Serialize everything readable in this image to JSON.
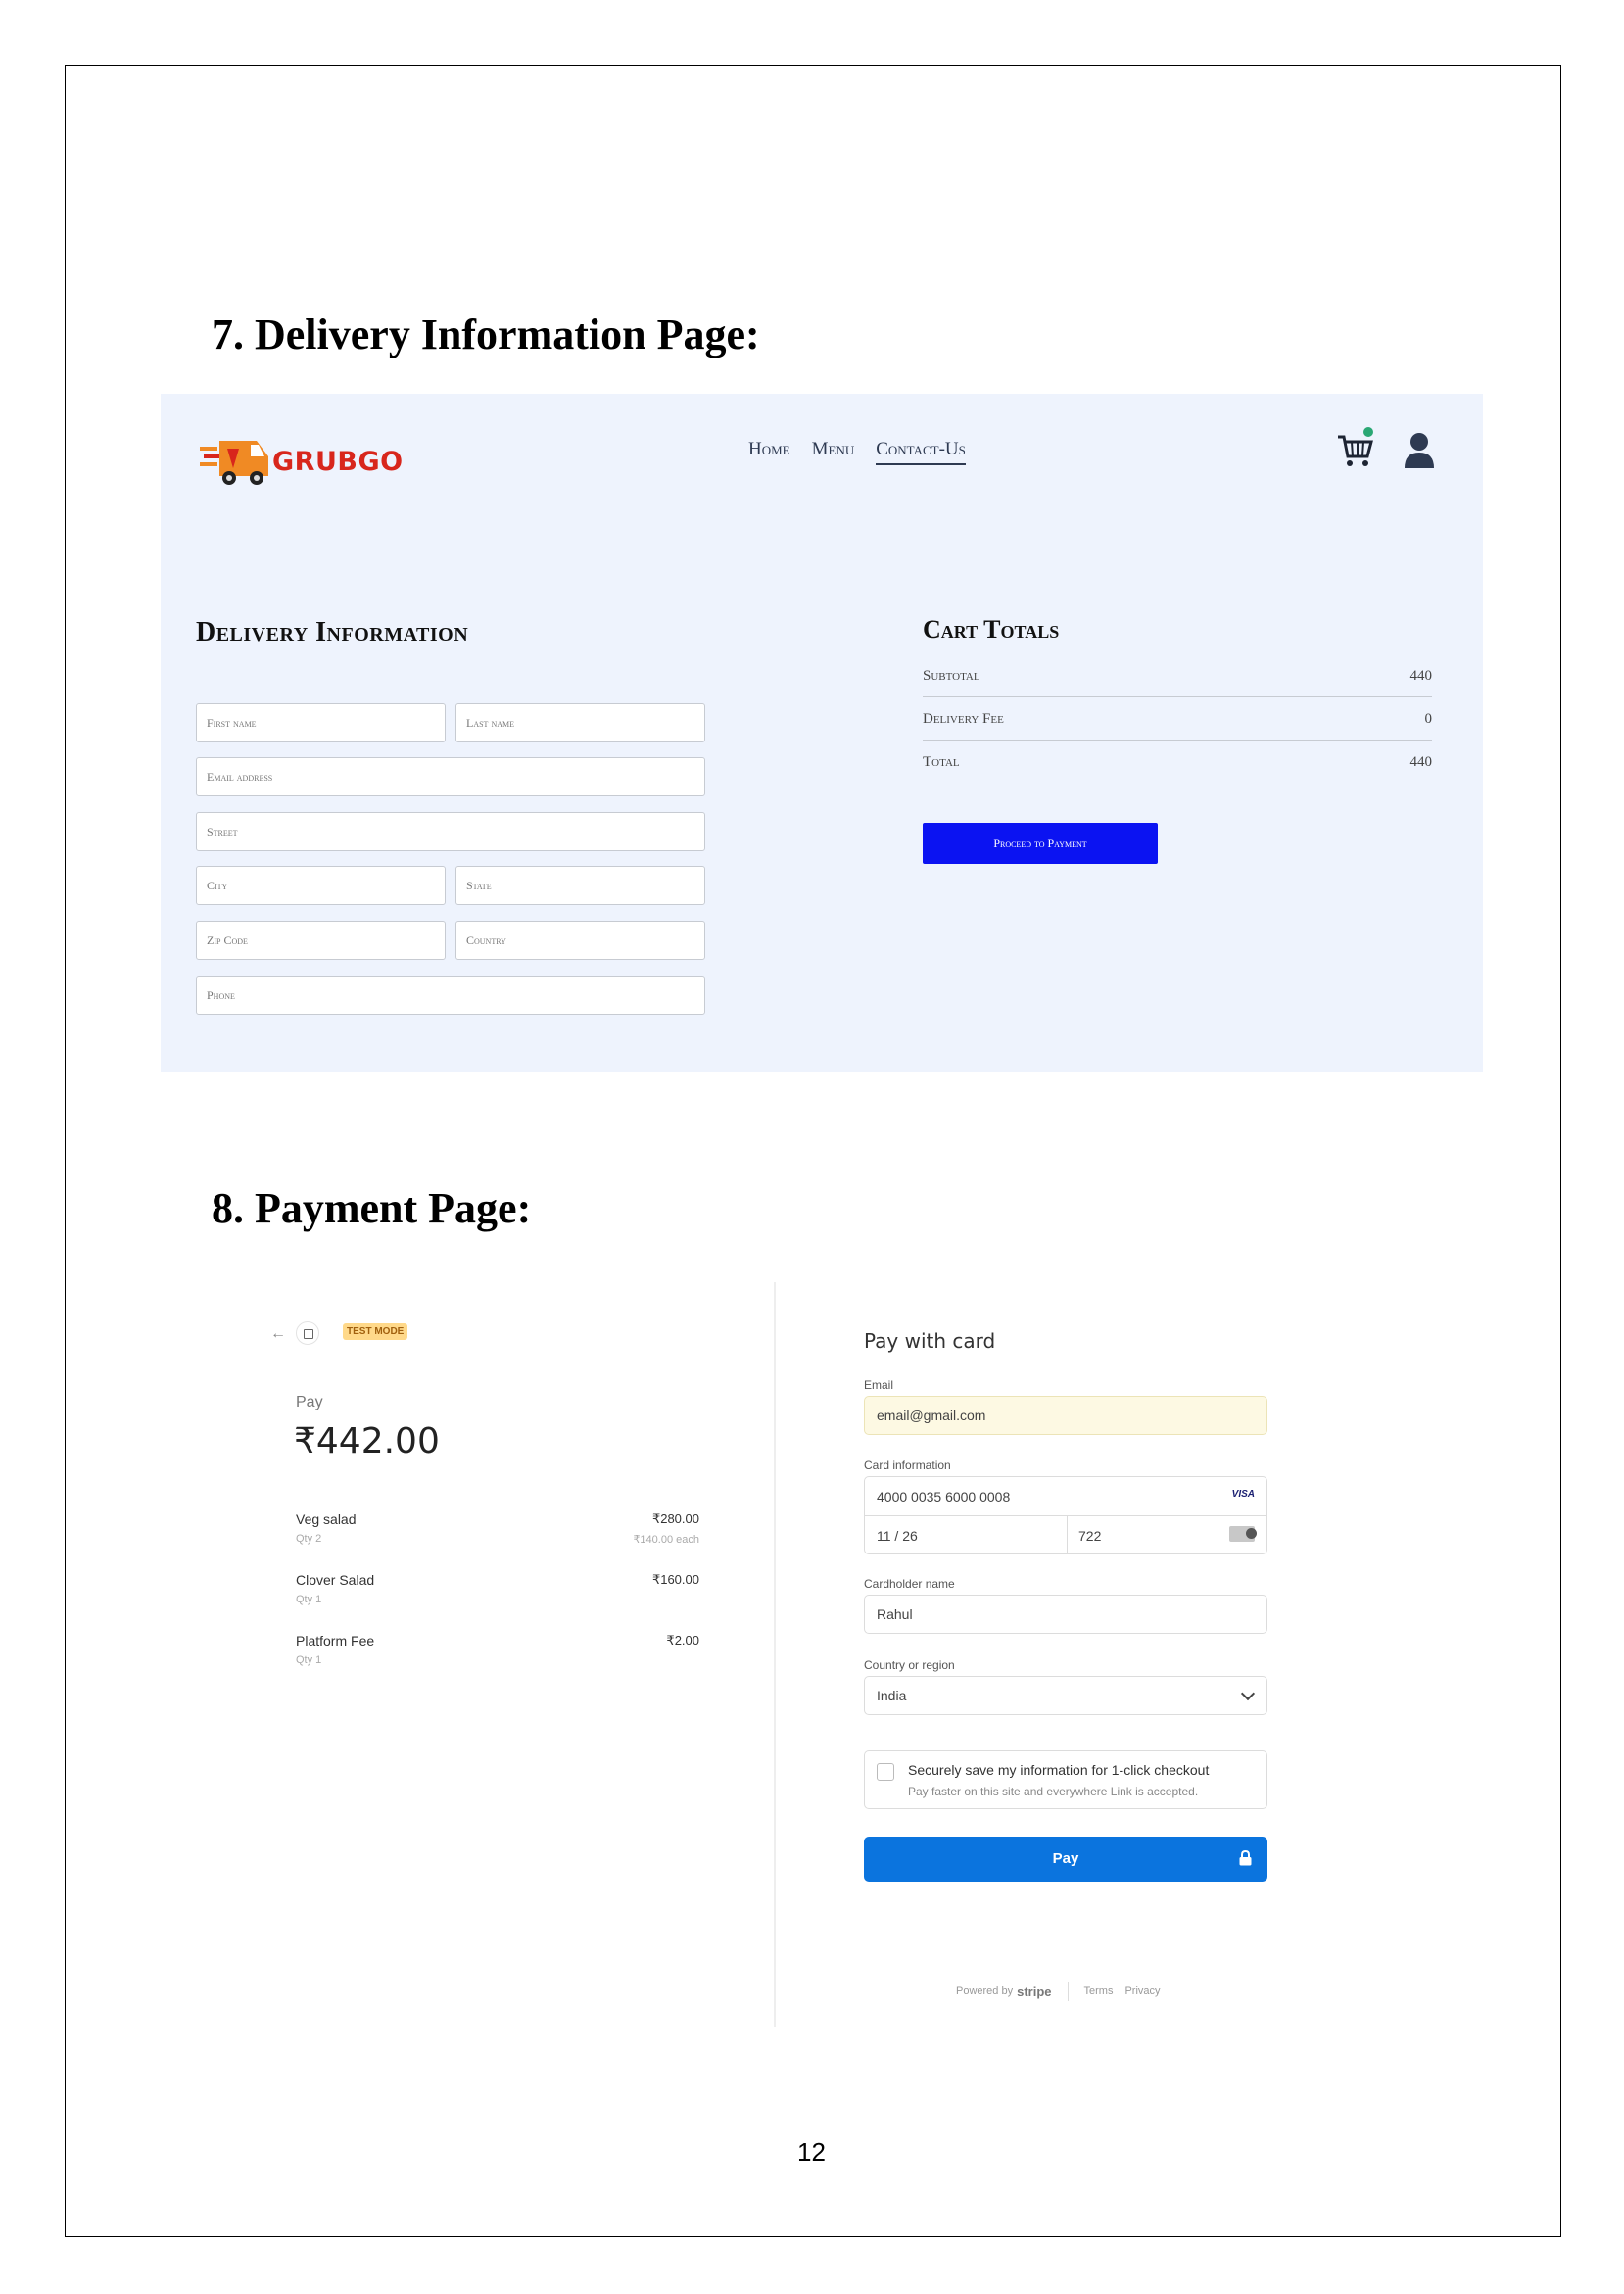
{
  "headings": {
    "delivery": "7. Delivery Information Page:",
    "payment": "8. Payment Page:"
  },
  "delivery_page": {
    "logo_text": "GRUBGO",
    "nav": [
      "Home",
      "Menu",
      "Contact-Us"
    ],
    "form_title": "Delivery Information",
    "fields": {
      "first_name": "First name",
      "last_name": "Last name",
      "email": "Email address",
      "street": "Street",
      "city": "City",
      "state": "State",
      "zip": "Zip Code",
      "country": "Country",
      "phone": "Phone"
    },
    "cart_totals": {
      "title": "Cart Totals",
      "rows": [
        {
          "label": "Subtotal",
          "value": "440"
        },
        {
          "label": "Delivery Fee",
          "value": "0"
        },
        {
          "label": "Total",
          "value": "440"
        }
      ],
      "button": "Proceed to Payment"
    },
    "colors": {
      "background": "#eef3fd",
      "button": "#0b13f2",
      "logo": "#d8261c",
      "cart_dot": "#2aa774"
    }
  },
  "payment_page": {
    "test_mode": "TEST MODE",
    "pay_label": "Pay",
    "amount": "₹442.00",
    "items": [
      {
        "name": "Veg salad",
        "qty": "Qty 2",
        "price": "₹280.00",
        "each": "₹140.00 each"
      },
      {
        "name": "Clover Salad",
        "qty": "Qty 1",
        "price": "₹160.00",
        "each": ""
      },
      {
        "name": "Platform Fee",
        "qty": "Qty 1",
        "price": "₹2.00",
        "each": ""
      }
    ],
    "form": {
      "title": "Pay with card",
      "email_label": "Email",
      "email_value": "email@gmail.com",
      "card_label": "Card information",
      "card_number": "4000 0035 6000 0008",
      "card_brand": "VISA",
      "expiry": "11 / 26",
      "cvc": "722",
      "holder_label": "Cardholder name",
      "holder_value": "Rahul",
      "country_label": "Country or region",
      "country_value": "India",
      "save_title": "Securely save my information for 1-click checkout",
      "save_sub": "Pay faster on this site and everywhere Link is accepted.",
      "pay_button": "Pay"
    },
    "footer": {
      "powered": "Powered by",
      "brand": "stripe",
      "terms": "Terms",
      "privacy": "Privacy"
    },
    "colors": {
      "pay_button": "#0b74de",
      "test_badge": "#ffd98a"
    }
  },
  "page_number": "12"
}
